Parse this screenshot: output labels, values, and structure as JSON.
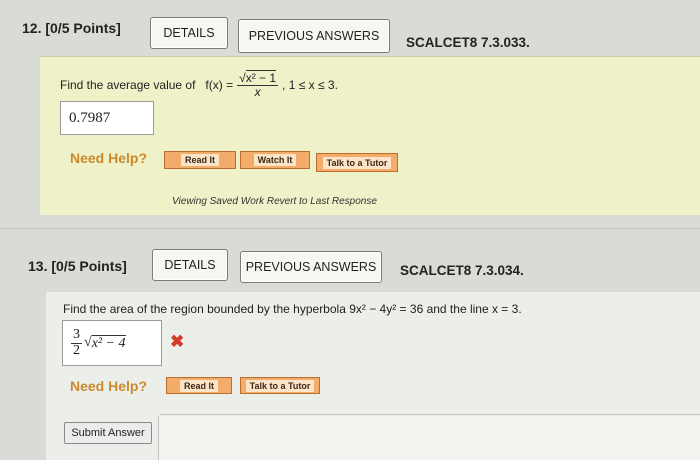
{
  "q12": {
    "number": "12.",
    "points": "[0/5 Points]",
    "details_label": "DETAILS",
    "prev_label": "PREVIOUS ANSWERS",
    "code": "SCALCET8 7.3.033.",
    "prompt_text": "Find the average value of",
    "fx": "f(x) =",
    "sqrt_expr": "x² − 1",
    "denom": "x",
    "domain": ", 1 ≤ x ≤ 3.",
    "answer": "0.7987",
    "need_help": "Need Help?",
    "help_read": "Read It",
    "help_watch": "Watch It",
    "help_tutor": "Talk to a Tutor",
    "saved_text": "Viewing Saved Work Revert to Last Response"
  },
  "q13": {
    "number": "13.",
    "points": "[0/5 Points]",
    "details_label": "DETAILS",
    "prev_label": "PREVIOUS ANSWERS",
    "code": "SCALCET8 7.3.034.",
    "prompt_text": "Find the area of the region bounded by the hyperbola 9x² − 4y² = 36 and the line x = 3.",
    "ans_num": "3",
    "ans_den": "2",
    "ans_root": "x² − 4",
    "wrong_mark": "✖",
    "need_help": "Need Help?",
    "help_read": "Read It",
    "help_tutor": "Talk to a Tutor",
    "submit_label": "Submit Answer"
  }
}
